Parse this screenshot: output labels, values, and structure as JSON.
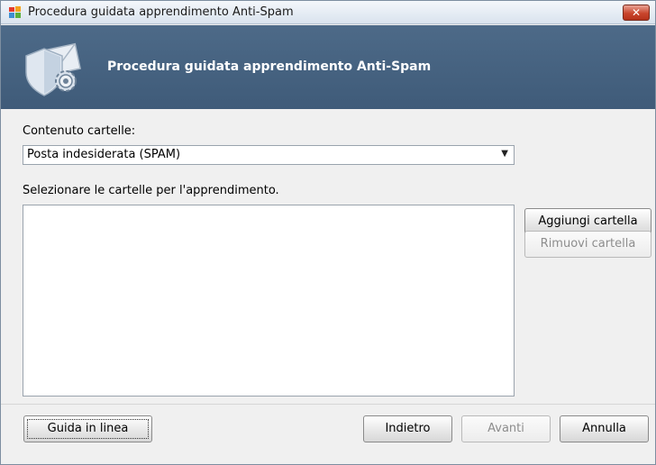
{
  "window": {
    "title": "Procedura guidata apprendimento Anti-Spam",
    "close_label": "✕"
  },
  "banner": {
    "title": "Procedura guidata apprendimento Anti-Spam"
  },
  "form": {
    "folder_content_label": "Contenuto cartelle:",
    "folder_content_value": "Posta indesiderata (SPAM)",
    "select_folders_label": "Selezionare le cartelle per l'apprendimento."
  },
  "side_buttons": {
    "add_folder": "Aggiungi cartella",
    "remove_folder": "Rimuovi cartella"
  },
  "footer": {
    "help": "Guida in linea",
    "back": "Indietro",
    "next": "Avanti",
    "cancel": "Annulla"
  },
  "colors": {
    "banner": "#4a6685",
    "close_button": "#c9452c"
  }
}
